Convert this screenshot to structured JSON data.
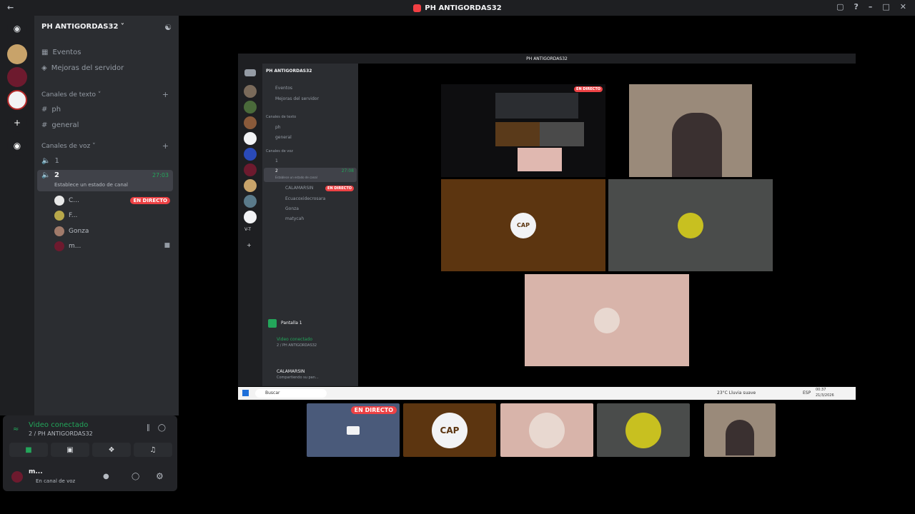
{
  "window": {
    "title": "PH ANTIGORDAS32"
  },
  "server": {
    "name": "PH ANTIGORDAS32"
  },
  "sidebar": {
    "top_items": [
      {
        "label": "Eventos"
      },
      {
        "label": "Mejoras del servidor"
      }
    ],
    "text_category": "Canales de texto",
    "text_channels": [
      "ph",
      "general"
    ],
    "voice_category": "Canales de voz",
    "voice_channels": [
      "1",
      "2"
    ],
    "active_channel": {
      "name": "2",
      "timer": "27:03",
      "status_hint": "Establece un estado de canal"
    },
    "voice_users": [
      {
        "name": "C...",
        "live": "EN DIRECTO"
      },
      {
        "name": "F..."
      },
      {
        "name": "Gonza"
      },
      {
        "name": "m..."
      }
    ]
  },
  "voice_panel": {
    "status": "Video conectado",
    "channel": "2 / PH ANTIGORDAS32"
  },
  "user": {
    "name": "m...",
    "status": "En canal de voz"
  },
  "inner_window": {
    "title": "PH ANTIGORDAS32",
    "server": "PH ANTIGORDAS32",
    "items": [
      "Eventos",
      "Mejoras del servidor"
    ],
    "text_category": "Canales de texto",
    "text_channels": [
      "ph",
      "general"
    ],
    "voice_category": "Canales de voz",
    "voice_channels": [
      "1",
      "2"
    ],
    "active_hint": "Establece un estado de canal",
    "timer": "27:08",
    "users": [
      "CALAMARSIN",
      "Ecuacoxidecrosara",
      "Gonza",
      "matycah"
    ],
    "live": "EN DIRECTO",
    "screen": "Pantalla 1",
    "status": "Video conectado",
    "channel": "2 / PH ANTIGORDAS32",
    "me": "CALAMARSIN",
    "me_status": "Compartiendo su pan...",
    "rail_label": "V-T",
    "search": "Buscar",
    "weather": "23°C Lluvia suave",
    "lang": "ESP",
    "time": "00:37",
    "date": "21/3/2026"
  },
  "tiles": {
    "screen_live": "EN DIRECTO",
    "cap": "CAP"
  },
  "strip": {
    "live": "EN DIRECTO",
    "cap": "CAP"
  }
}
